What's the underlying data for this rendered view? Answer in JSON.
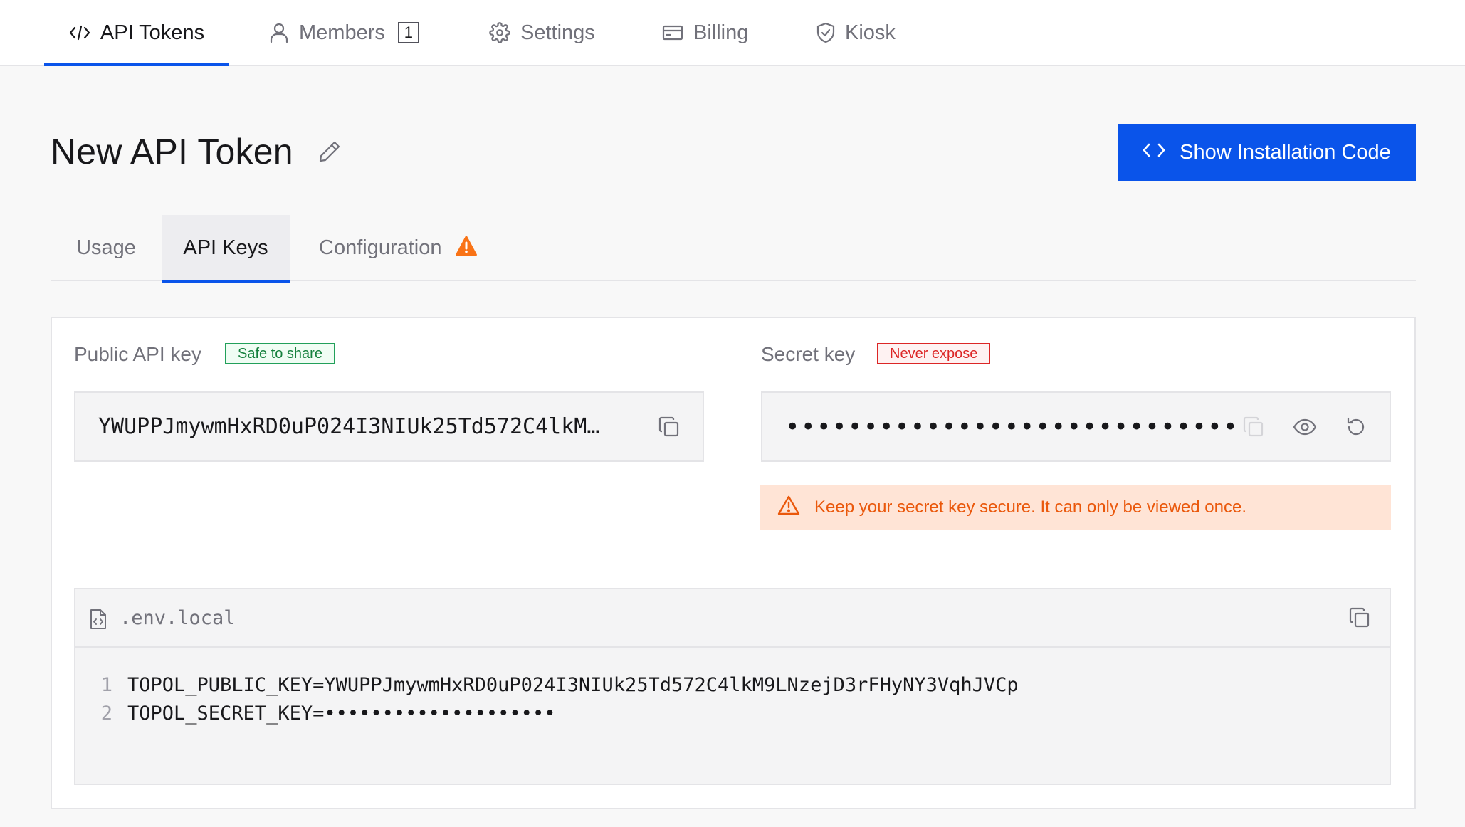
{
  "topnav": {
    "tabs": [
      {
        "label": "API Tokens",
        "icon": "code-icon",
        "active": true
      },
      {
        "label": "Members",
        "icon": "user-icon",
        "badge": "1"
      },
      {
        "label": "Settings",
        "icon": "gear-icon"
      },
      {
        "label": "Billing",
        "icon": "credit-card-icon"
      },
      {
        "label": "Kiosk",
        "icon": "shield-icon"
      }
    ]
  },
  "header": {
    "title": "New API Token",
    "install_button": "Show Installation Code"
  },
  "subtabs": [
    {
      "label": "Usage"
    },
    {
      "label": "API Keys",
      "active": true
    },
    {
      "label": "Configuration",
      "warning": true
    }
  ],
  "public_key": {
    "label": "Public API key",
    "tag": "Safe to share",
    "value": "YWUPPJmywmHxRD0uP024I3NIUk25Td572C4lkM…"
  },
  "secret_key": {
    "label": "Secret key",
    "tag": "Never expose",
    "value": "••••••••••••••••••••••••••••••••…",
    "warning": "Keep your secret key secure. It can only be viewed once."
  },
  "env_file": {
    "filename": ".env.local",
    "lines": [
      {
        "n": "1",
        "text": "TOPOL_PUBLIC_KEY=YWUPPJmywmHxRD0uP024I3NIUk25Td572C4lkM9LNzejD3rFHyNY3VqhJVCp"
      },
      {
        "n": "2",
        "text": "TOPOL_SECRET_KEY=••••••••••••••••••••"
      }
    ]
  },
  "colors": {
    "accent": "#0a54ea",
    "safe": "#15803d",
    "danger": "#dc2626",
    "warning": "#ea580c",
    "warning_bg": "#ffe4d6"
  }
}
